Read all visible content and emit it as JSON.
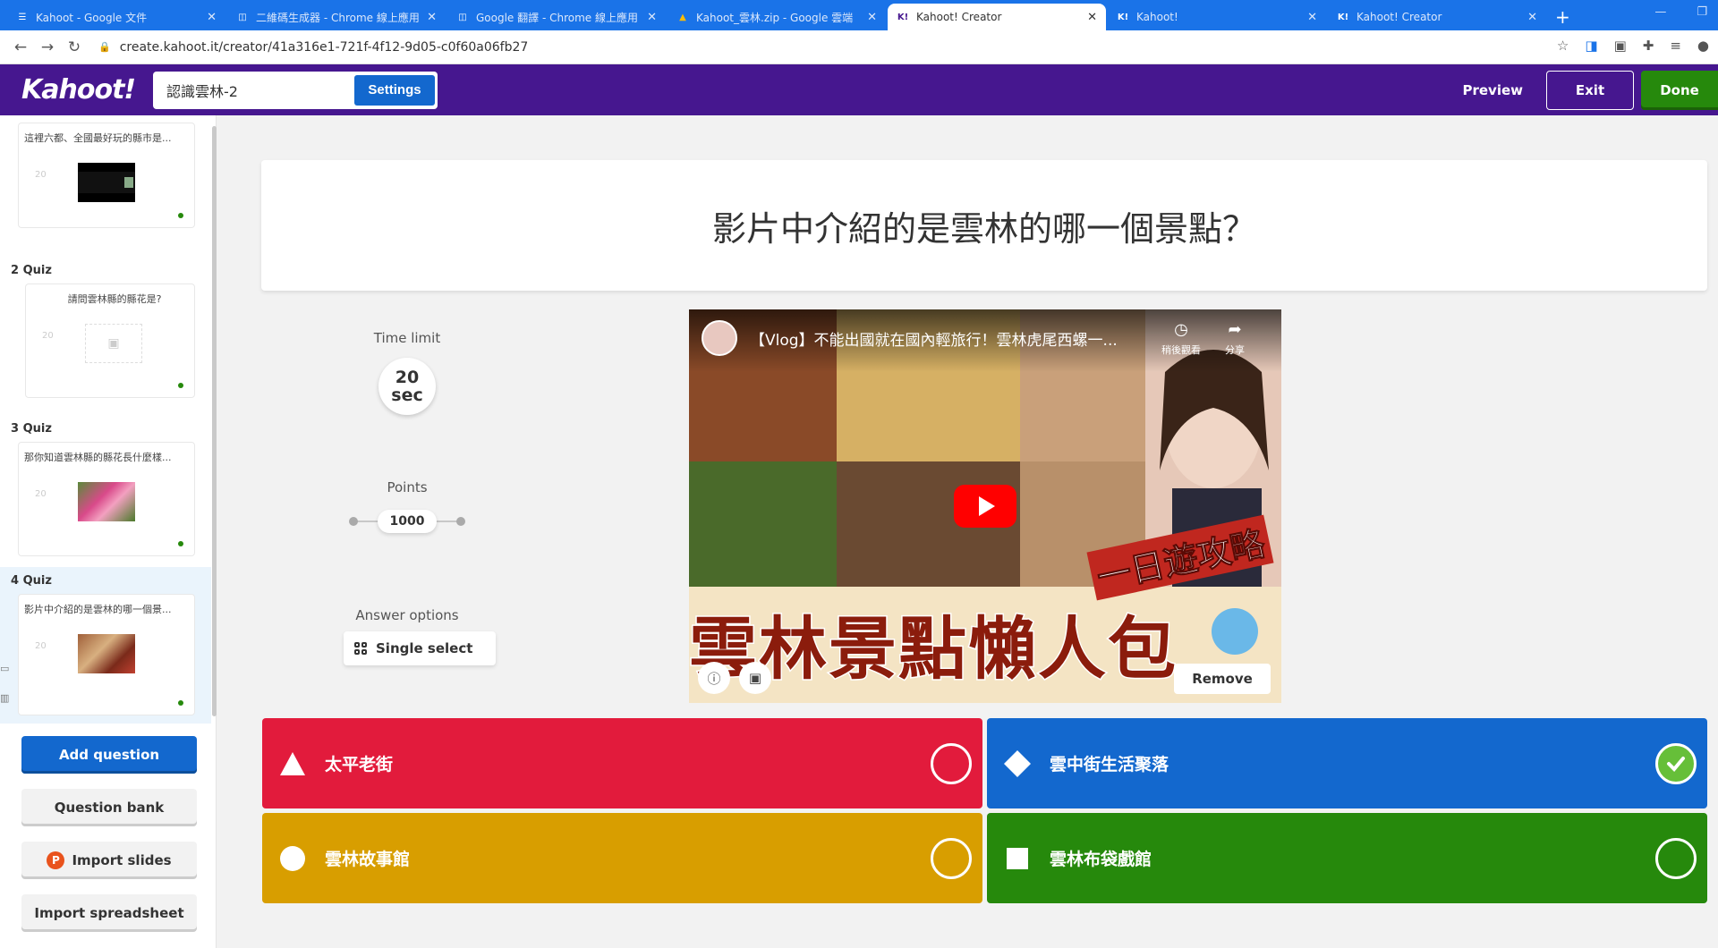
{
  "browser": {
    "tabs": [
      {
        "title": "Kahoot - Google 文件",
        "icon": "docs-icon",
        "active": false
      },
      {
        "title": "二維碼生成器 - Chrome 線上應用",
        "icon": "chrome-store-icon",
        "active": false
      },
      {
        "title": "Google 翻譯 - Chrome 線上應用",
        "icon": "chrome-store-icon",
        "active": false
      },
      {
        "title": "Kahoot_雲林.zip - Google 雲端",
        "icon": "drive-icon",
        "active": false
      },
      {
        "title": "Kahoot! Creator",
        "icon": "kahoot-icon",
        "active": true
      },
      {
        "title": "Kahoot!",
        "icon": "kahoot-icon",
        "active": false
      },
      {
        "title": "Kahoot! Creator",
        "icon": "kahoot-icon",
        "active": false
      }
    ],
    "url": "create.kahoot.it/creator/41a316e1-721f-4f12-9d05-c0f60a06fb27"
  },
  "header": {
    "logo": "Kahoot!",
    "kahoot_title": "認識雲林-2",
    "settings_label": "Settings",
    "preview_label": "Preview",
    "exit_label": "Exit",
    "done_label": "Done"
  },
  "sidebar": {
    "slides": [
      {
        "label": "",
        "text": "這裡六都、全國最好玩的縣市是...",
        "time": "20",
        "thumb": "dark"
      },
      {
        "label": "2  Quiz",
        "text": "請問雲林縣的縣花是?",
        "time": "20",
        "thumb": "placeholder"
      },
      {
        "label": "3  Quiz",
        "text": "那你知道雲林縣的縣花長什麼樣...",
        "time": "20",
        "thumb": "flower"
      },
      {
        "label": "4  Quiz",
        "text": "影片中介紹的是雲林的哪一個景...",
        "time": "20",
        "thumb": "video"
      }
    ],
    "add_question": "Add question",
    "question_bank": "Question bank",
    "import_slides": "Import slides",
    "import_spreadsheet": "Import spreadsheet"
  },
  "question": {
    "text": "影片中介紹的是雲林的哪一個景點？"
  },
  "options": {
    "time_limit_label": "Time limit",
    "time_value": "20",
    "time_unit": "sec",
    "points_label": "Points",
    "points_value": "1000",
    "answer_options_label": "Answer options",
    "answer_type": "Single select"
  },
  "video": {
    "title": "【Vlog】不能出國就在國內輕旅行！雲林虎尾西螺一...",
    "watch_later": "稍後觀看",
    "share": "分享",
    "overlay_big": "雲林景點懶人包",
    "overlay_small": "一日遊攻略",
    "remove_label": "Remove"
  },
  "answers": [
    {
      "text": "太平老街",
      "color": "#e21b3c",
      "shape": "triangle-icon",
      "correct": false
    },
    {
      "text": "雲中街生活聚落",
      "color": "#1368ce",
      "shape": "diamond-icon",
      "correct": true
    },
    {
      "text": "雲林故事館",
      "color": "#d89e00",
      "shape": "circle-icon",
      "correct": false
    },
    {
      "text": "雲林布袋戲館",
      "color": "#26890c",
      "shape": "square-icon",
      "correct": false
    }
  ]
}
